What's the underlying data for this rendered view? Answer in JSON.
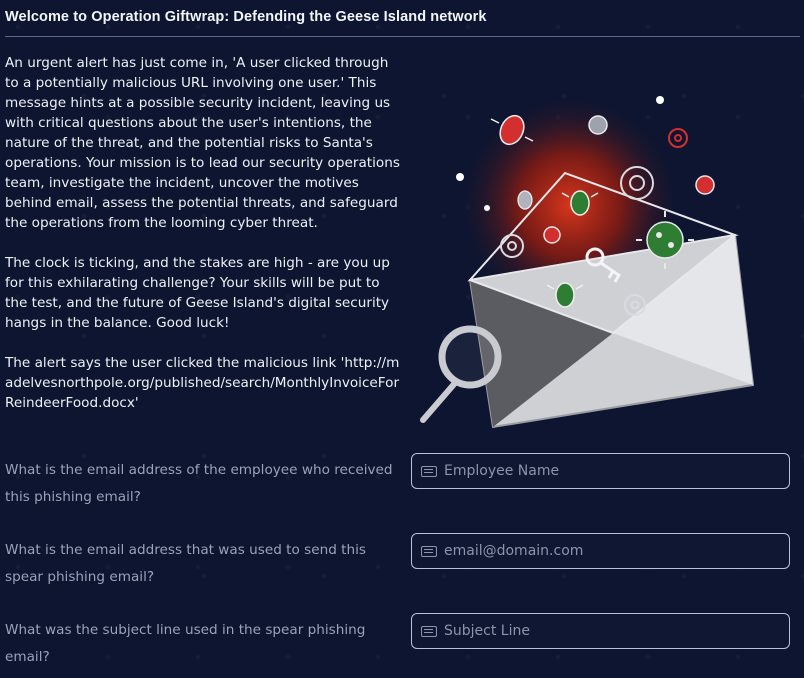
{
  "header": {
    "title": "Welcome to Operation Giftwrap: Defending the Geese Island network"
  },
  "intro": {
    "paragraph_1": "An urgent alert has just come in, 'A user clicked through to a potentially malicious URL involving one user.' This message hints at a possible security incident, leaving us with critical questions about the user's intentions, the nature of the threat, and the potential risks to Santa's operations. Your mission is to lead our security operations team, investigate the incident, uncover the motives behind email, assess the potential threats, and safeguard the operations from the looming cyber threat.",
    "paragraph_2": "The clock is ticking, and the stakes are high - are you up for this exhilarating challenge? Your skills will be put to the test, and the future of Geese Island's digital security hangs in the balance. Good luck!",
    "paragraph_3": "The alert says the user clicked the malicious link 'http://madelvesnorthpole.org/published/search/MonthlyInvoiceForReindeerFood.docx'"
  },
  "questions": [
    {
      "label": "What is the email address of the employee who received this phishing email?",
      "placeholder": "Employee Name",
      "value": ""
    },
    {
      "label": "What is the email address that was used to send this spear phishing email?",
      "placeholder": "email@domain.com",
      "value": ""
    },
    {
      "label": "What was the subject line used in the spear phishing email?",
      "placeholder": "Subject Line",
      "value": ""
    }
  ],
  "icons": {
    "input_icon": "keyboard-icon",
    "illustration": "phishing-envelope-illustration"
  },
  "colors": {
    "background": "#0d1530",
    "text": "#eef1f7",
    "muted_text": "#9aa3b8",
    "field_border": "#b9c1d6",
    "glow": "#c8301a",
    "virus_green": "#2e7d32",
    "bug_red": "#d32f2f"
  }
}
